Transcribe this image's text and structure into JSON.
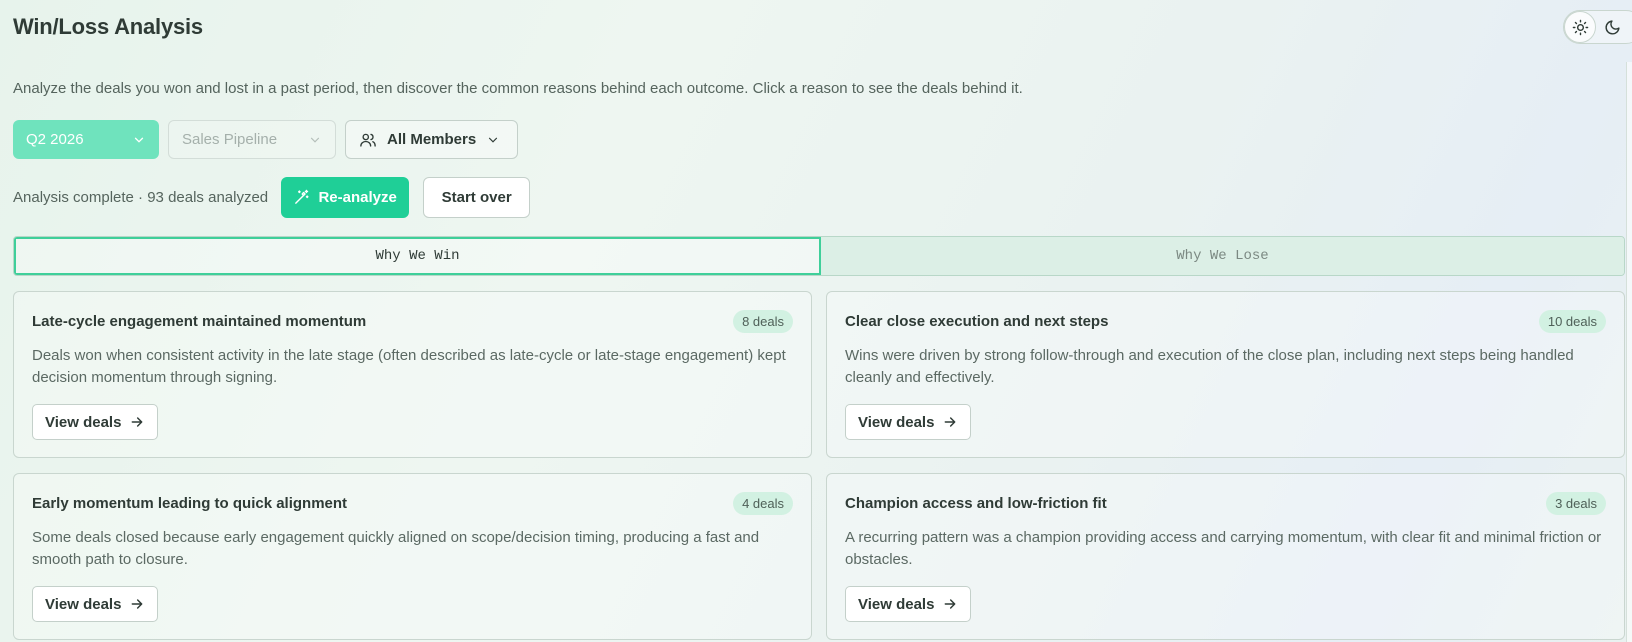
{
  "header": {
    "title": "Win/Loss Analysis",
    "description": "Analyze the deals you won and lost in a past period, then discover the common reasons behind each outcome. Click a reason to see the deals behind it."
  },
  "theme": {
    "light_icon": "sun-icon",
    "dark_icon": "moon-icon"
  },
  "filters": {
    "period": "Q2 2026",
    "pipeline": "Sales Pipeline",
    "members": "All Members"
  },
  "status": {
    "text": "Analysis complete · 93 deals analyzed",
    "reanalyze_label": "Re-analyze",
    "start_over_label": "Start over"
  },
  "tabs": [
    {
      "label": "Why We Win",
      "active": true
    },
    {
      "label": "Why We Lose",
      "active": false
    }
  ],
  "cards": [
    {
      "title": "Late-cycle engagement maintained momentum",
      "badge": "8 deals",
      "description": "Deals won when consistent activity in the late stage (often described as late-cycle or late-stage engagement) kept decision momentum through signing.",
      "button": "View deals"
    },
    {
      "title": "Clear close execution and next steps",
      "badge": "10 deals",
      "description": "Wins were driven by strong follow-through and execution of the close plan, including next steps being handled cleanly and effectively.",
      "button": "View deals"
    },
    {
      "title": "Early momentum leading to quick alignment",
      "badge": "4 deals",
      "description": "Some deals closed because early engagement quickly aligned on scope/decision timing, producing a fast and smooth path to closure.",
      "button": "View deals"
    },
    {
      "title": "Champion access and low-friction fit",
      "badge": "3 deals",
      "description": "A recurring pattern was a champion providing access and carrying momentum, with clear fit and minimal friction or obstacles.",
      "button": "View deals"
    }
  ],
  "colors": {
    "accent": "#1fcf97",
    "period_select": "#6fe3bd",
    "badge_bg": "#d2f1e2"
  }
}
